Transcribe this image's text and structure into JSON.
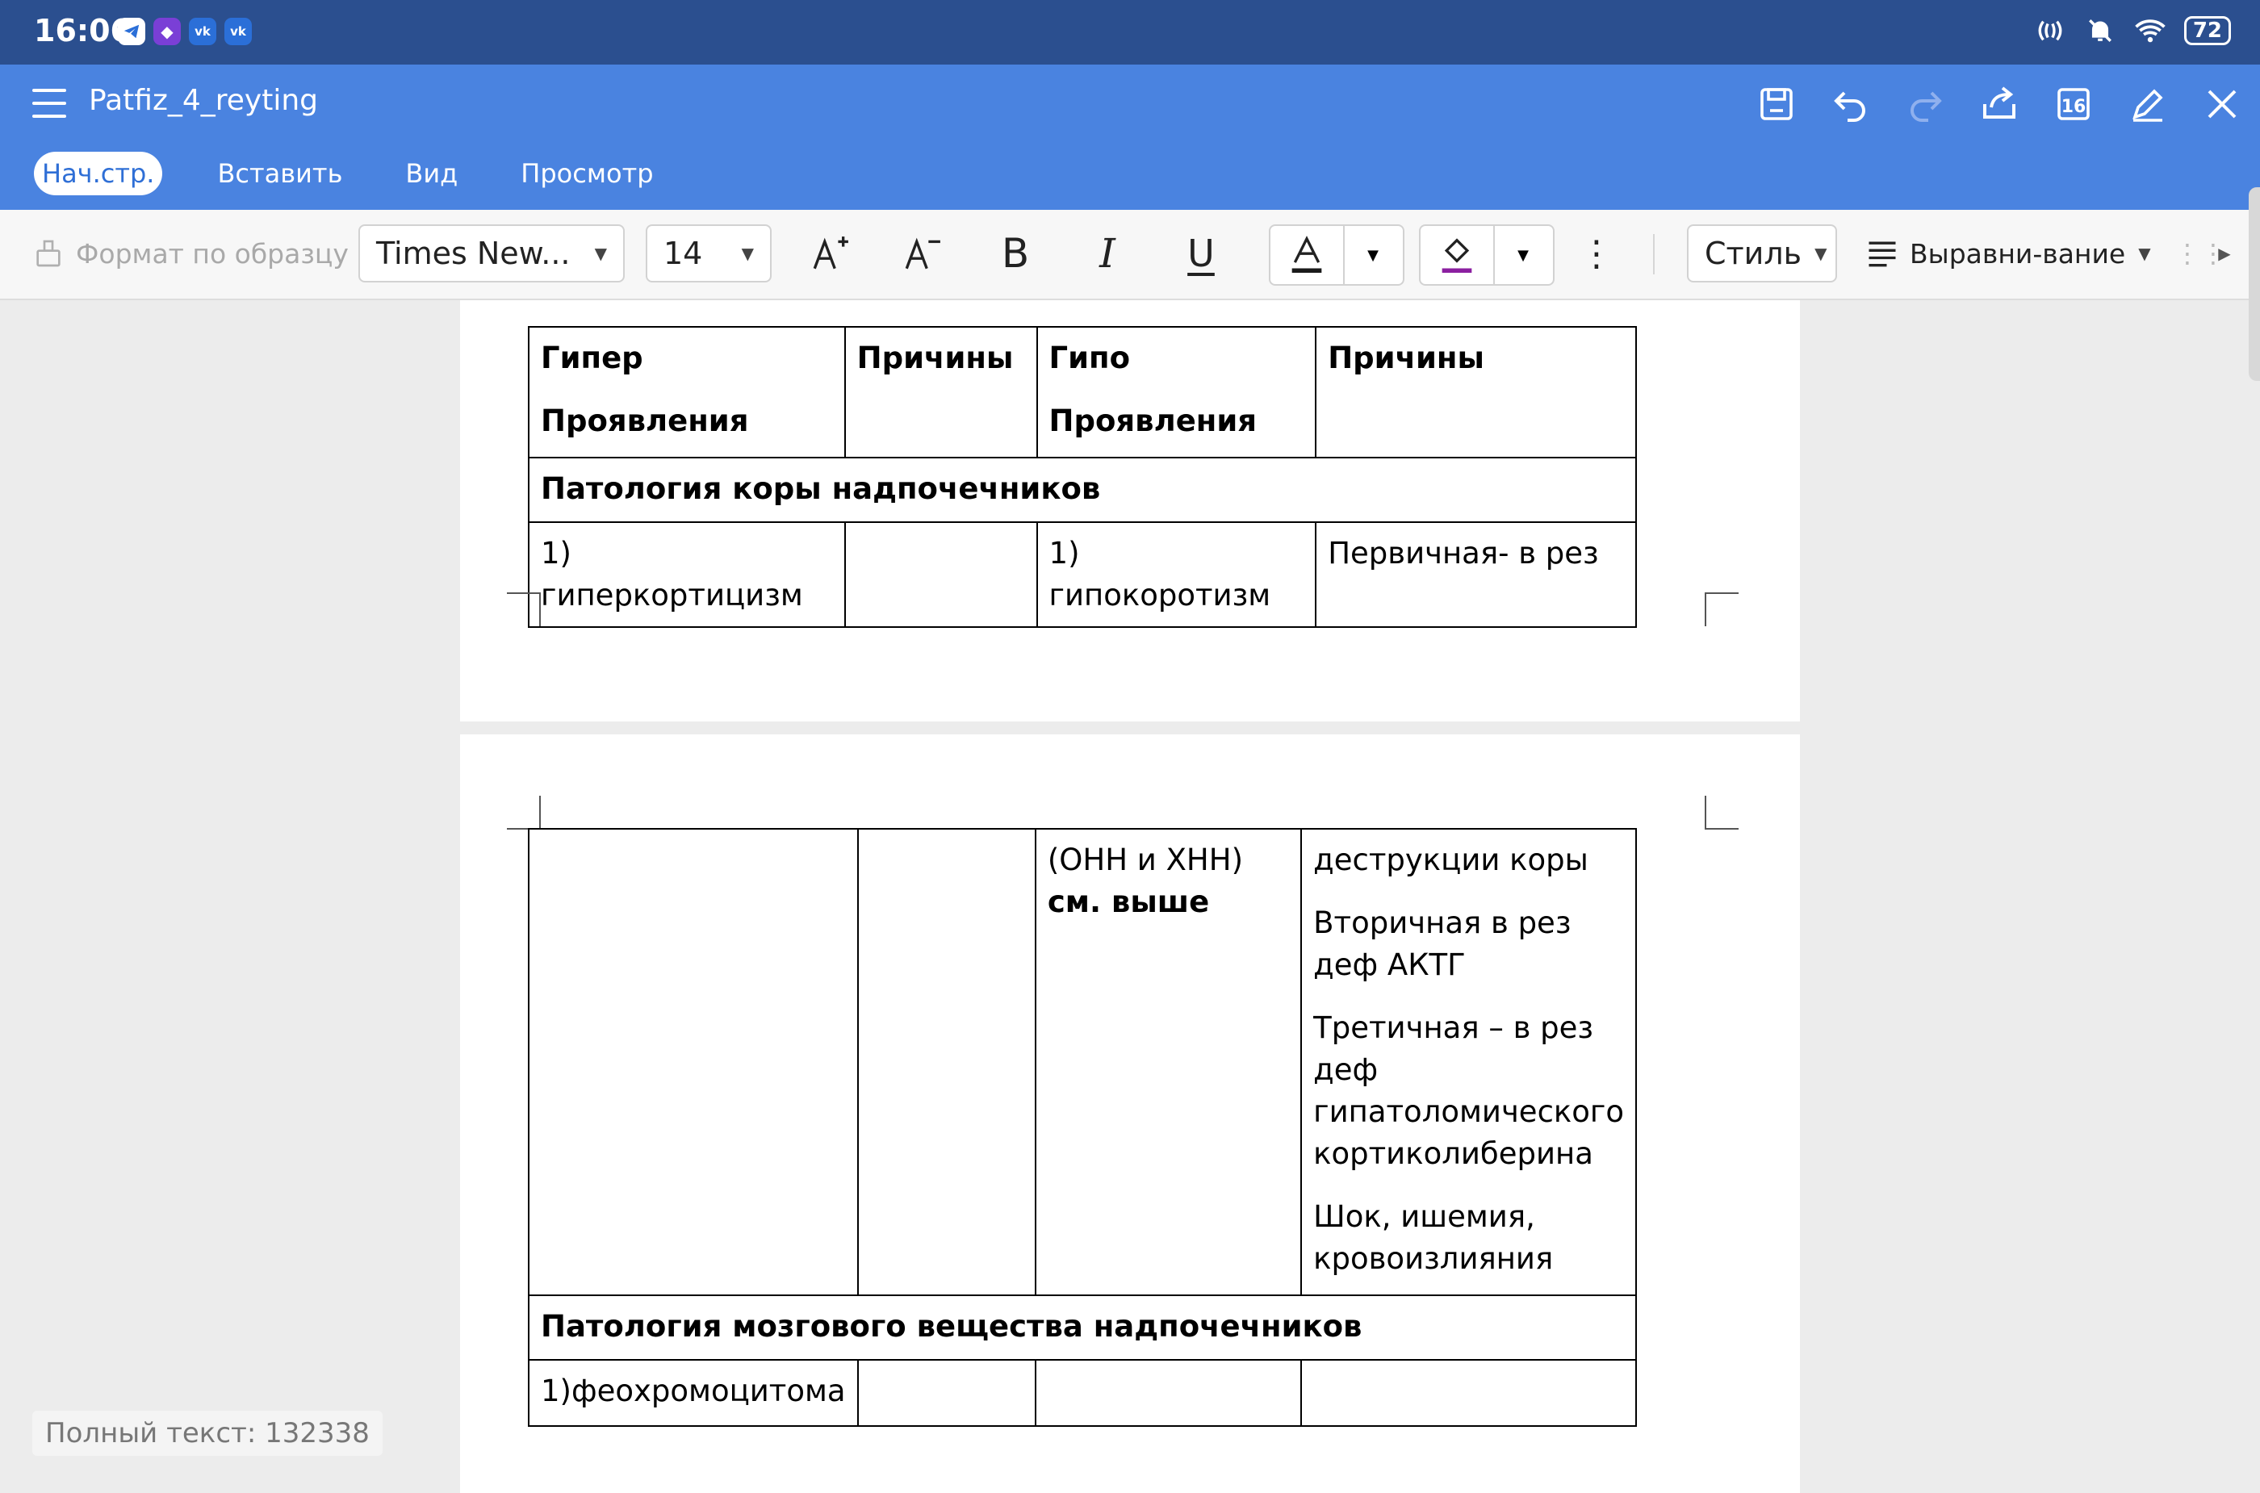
{
  "status_bar": {
    "time": "16:06",
    "battery": "72",
    "notification_icons": [
      "telegram-icon",
      "twitch-icon",
      "vk-icon",
      "vk-icon"
    ],
    "right_icons": [
      "nfc-icon",
      "mute-bell-icon",
      "wifi-icon"
    ]
  },
  "header": {
    "title": "Patfiz_4_reyting",
    "actions": [
      "save-icon",
      "undo-icon",
      "redo-icon",
      "share-icon",
      "page-count-icon",
      "edit-icon",
      "close-icon"
    ],
    "page_count_label": "16"
  },
  "tabs": [
    {
      "label": "Нач.стр.",
      "active": true
    },
    {
      "label": "Вставить",
      "active": false
    },
    {
      "label": "Вид",
      "active": false
    },
    {
      "label": "Просмотр",
      "active": false
    }
  ],
  "toolbar": {
    "format_painter": "Формат по образцу",
    "font_family": "Times New...",
    "font_size": "14",
    "style": "Стиль",
    "align": "Выравни-вание",
    "font_color": "#1a1a1a",
    "highlight_color": "#8b1fa0"
  },
  "table1": {
    "header": {
      "c1_line1": "Гипер",
      "c1_line2": "Проявления",
      "c2": "Причины",
      "c3_line1": "Гипо",
      "c3_line2": "Проявления",
      "c4": "Причины"
    },
    "section": "Патология коры надпочечников",
    "row": {
      "c1": "1) гиперкортицизм",
      "c2": "",
      "c3": "1) гипокоротизм",
      "c4": "Первичная- в рез"
    }
  },
  "table2": {
    "c3_plain": "(ОНН и ХНН) ",
    "c3_bold": "см. выше",
    "c4_paragraphs": [
      "деструкции коры",
      "Вторичная в рез деф АКТГ",
      "Третичная – в рез деф гипатоломического кортиколиберина",
      "Шок, ишемия, кровоизлияния"
    ],
    "section": "Патология мозгового вещества надпочечников",
    "row": {
      "c1": "1)феохромоцитома",
      "c2": "",
      "c3": "",
      "c4": ""
    }
  },
  "footer": {
    "full_text": "Полный текст: 132338"
  }
}
